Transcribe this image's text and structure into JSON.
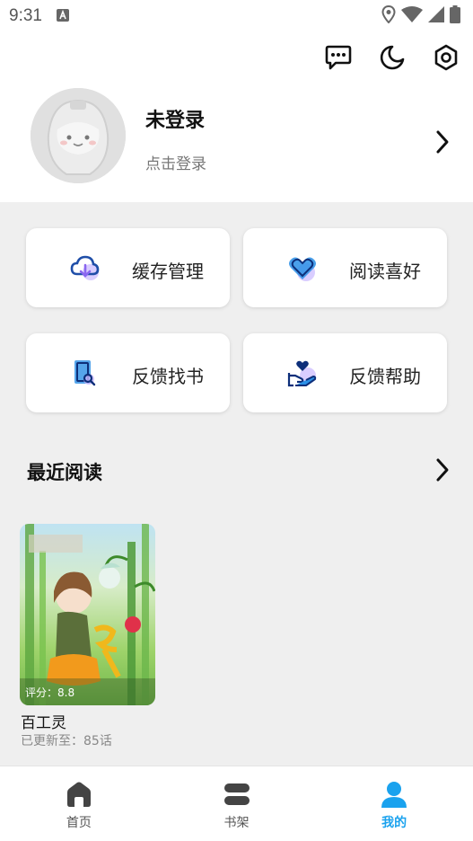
{
  "status_bar": {
    "time": "9:31"
  },
  "header": {
    "icons": [
      "message-icon",
      "moon-icon",
      "settings-icon"
    ]
  },
  "profile": {
    "name": "未登录",
    "subtitle": "点击登录"
  },
  "quick_actions": [
    {
      "label": "缓存管理",
      "icon": "cloud-download-icon"
    },
    {
      "label": "阅读喜好",
      "icon": "heart-icon"
    },
    {
      "label": "反馈找书",
      "icon": "search-book-icon"
    },
    {
      "label": "反馈帮助",
      "icon": "heart-hand-icon"
    }
  ],
  "recent": {
    "title": "最近阅读",
    "books": [
      {
        "title": "百工灵",
        "rating": "评分：8.8",
        "update": "已更新至：85话"
      }
    ]
  },
  "bottom_nav": [
    {
      "label": "首页",
      "icon": "home-icon",
      "active": false
    },
    {
      "label": "书架",
      "icon": "bookshelf-icon",
      "active": false
    },
    {
      "label": "我的",
      "icon": "user-icon",
      "active": true
    }
  ],
  "colors": {
    "accent": "#1aa2ee",
    "icon_blue": "#2a8fe6",
    "icon_purple": "#8a66f0"
  }
}
